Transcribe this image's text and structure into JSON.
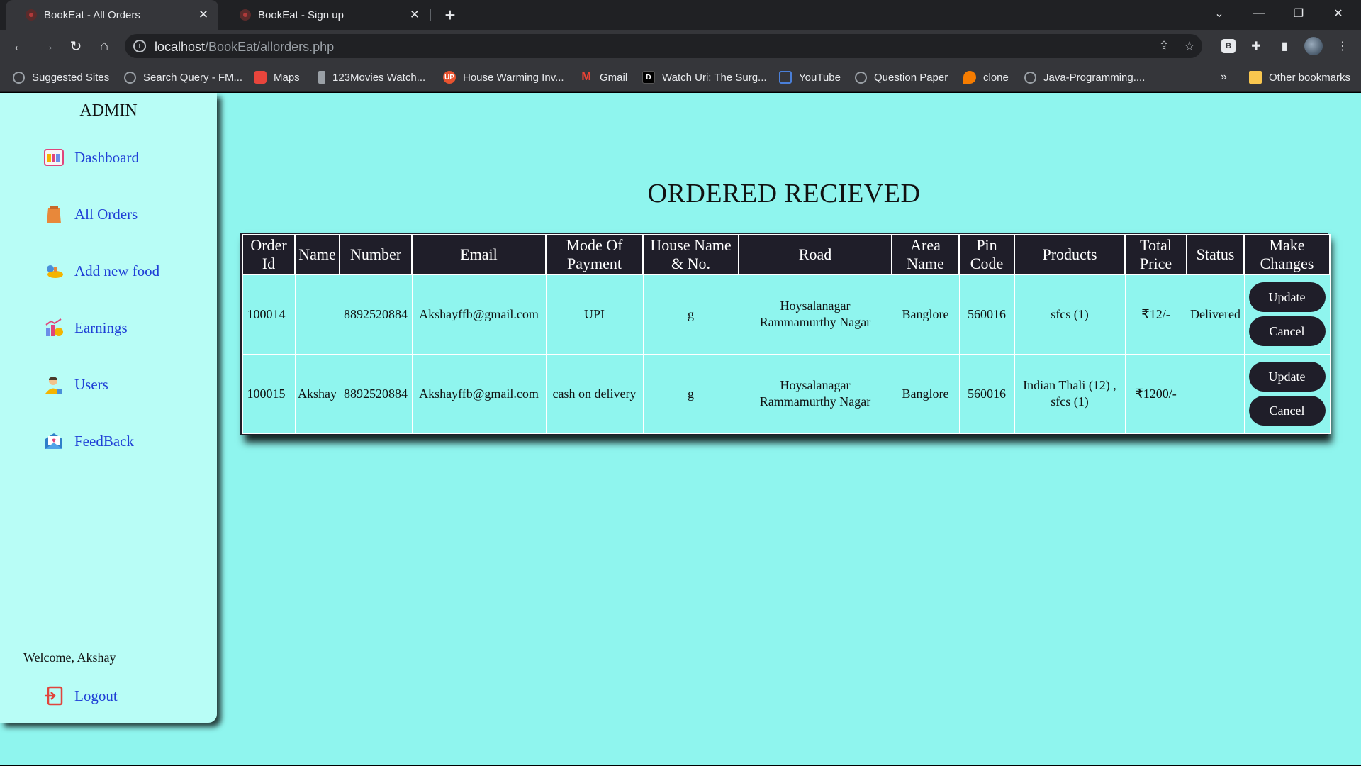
{
  "browser": {
    "tabs": [
      {
        "title": "BookEat - All Orders",
        "active": true
      },
      {
        "title": "BookEat - Sign up",
        "active": false
      }
    ],
    "url_host": "localhost",
    "url_path": "/BookEat/allorders.php",
    "bookmarks": [
      {
        "label": "Suggested Sites",
        "icon": "globe-icon"
      },
      {
        "label": "Search Query - FM...",
        "icon": "globe-icon"
      },
      {
        "label": "Maps",
        "icon": "maps-icon"
      },
      {
        "label": "123Movies Watch...",
        "icon": "movie-icon"
      },
      {
        "label": "House Warming Inv...",
        "icon": "up-icon"
      },
      {
        "label": "Gmail",
        "icon": "gmail-icon"
      },
      {
        "label": "Watch Uri: The Surg...",
        "icon": "d-icon"
      },
      {
        "label": "YouTube",
        "icon": "youtube-icon"
      },
      {
        "label": "Question Paper",
        "icon": "globe-icon"
      },
      {
        "label": "clone",
        "icon": "flame-icon"
      },
      {
        "label": "Java-Programming....",
        "icon": "globe-icon"
      }
    ],
    "overflow": "»",
    "other_bookmarks": "Other bookmarks"
  },
  "sidebar": {
    "brand": "ADMIN",
    "items": [
      {
        "label": "Dashboard",
        "icon": "dashboard-icon"
      },
      {
        "label": "All Orders",
        "icon": "orders-icon"
      },
      {
        "label": "Add new food",
        "icon": "food-icon"
      },
      {
        "label": "Earnings",
        "icon": "earnings-icon"
      },
      {
        "label": "Users",
        "icon": "users-icon"
      },
      {
        "label": "FeedBack",
        "icon": "feedback-icon"
      }
    ],
    "welcome": "Welcome, Akshay",
    "logout": "Logout"
  },
  "main": {
    "title": "ORDERED RECIEVED",
    "headers": [
      "Order Id",
      "Name",
      "Number",
      "Email",
      "Mode Of Payment",
      "House Name & No.",
      "Road",
      "Area Name",
      "Pin Code",
      "Products",
      "Total Price",
      "Status",
      "Make Changes"
    ],
    "rows": [
      {
        "order_id": "100014",
        "name": "",
        "number": "8892520884",
        "email": "Akshayffb@gmail.com",
        "payment": "UPI",
        "house": "g",
        "road": "Hoysalanagar Rammamurthy Nagar",
        "area": "Banglore",
        "pin": "560016",
        "products": "sfcs (1)",
        "total": "₹12/-",
        "status": "Delivered",
        "update": "Update",
        "cancel": "Cancel"
      },
      {
        "order_id": "100015",
        "name": "Akshay",
        "number": "8892520884",
        "email": "Akshayffb@gmail.com",
        "payment": "cash on delivery",
        "house": "g",
        "road": "Hoysalanagar Rammamurthy Nagar",
        "area": "Banglore",
        "pin": "560016",
        "products": "Indian Thali (12) , sfcs (1)",
        "total": "₹1200/-",
        "status": "",
        "update": "Update",
        "cancel": "Cancel"
      }
    ]
  }
}
